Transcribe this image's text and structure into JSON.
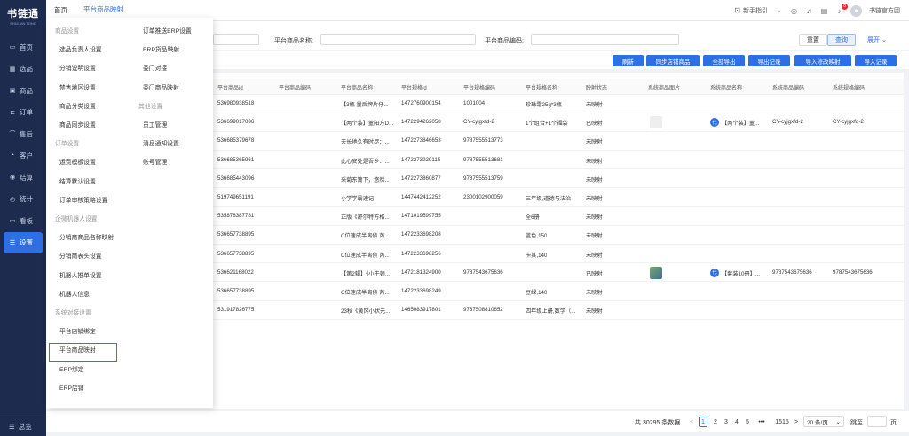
{
  "app": {
    "logo": "书链通",
    "logo_sub": "SHULIAN TONG"
  },
  "sidebar": {
    "items": [
      {
        "label": "首页",
        "icon": "monitor-icon"
      },
      {
        "label": "选品",
        "icon": "grid-icon"
      },
      {
        "label": "商品",
        "icon": "box-icon"
      },
      {
        "label": "订单",
        "icon": "cart-icon"
      },
      {
        "label": "售后",
        "icon": "headset-icon"
      },
      {
        "label": "客户",
        "icon": "user-icon"
      },
      {
        "label": "结算",
        "icon": "coin-icon"
      },
      {
        "label": "统计",
        "icon": "chart-icon"
      },
      {
        "label": "看板",
        "icon": "dashboard-icon"
      },
      {
        "label": "设置",
        "icon": "settings-icon"
      }
    ],
    "active_index": 9,
    "bottom_label": "总览"
  },
  "topbar": {
    "tabs": [
      "首页",
      "平台商品映射"
    ],
    "active_tab": 1,
    "guide_label": "新手指引",
    "notification_count": "8",
    "user_name": "书链官方团"
  },
  "filters": {
    "platform_name_label": "平台商品名称:",
    "platform_code_label": "平台商品编码:",
    "reset": "重置",
    "query": "查询",
    "expand": "展开"
  },
  "actions": {
    "buttons": [
      "刷新",
      "同步店铺商品",
      "全部导出",
      "导出记录",
      "导入修改映射",
      "导入记录"
    ]
  },
  "table": {
    "columns": [
      "平台商品id",
      "平台商品编码",
      "平台商品名称",
      "平台规格id",
      "平台规格编码",
      "平台规格名称",
      "映射状态",
      "系统商品图片",
      "系统商品名称",
      "系统商品编码",
      "系统规格编码"
    ],
    "rows": [
      {
        "pid": "536980938518",
        "code": "",
        "name": "【3瓶 量后牌片仔...",
        "sid": "1472760900154",
        "scode": "1001004",
        "sname": "珍珠霜25g*3瓶",
        "status": "未映射",
        "img": "",
        "sysname": "",
        "syscode": "",
        "sysscode": ""
      },
      {
        "pid": "536699017036",
        "code": "",
        "name": "【两个装】董阳方D...",
        "sid": "1472294262058",
        "scode": "CY-cyjgxfd-2",
        "sname": "1个组合+1个福袋",
        "status": "已映射",
        "img": "grey",
        "sysname": "【两个装】董...",
        "syscode": "CY-cyjgxfd-2",
        "sysscode": "CY-cyjgxfd-2"
      },
      {
        "pid": "536685379678",
        "code": "",
        "name": "天长地久有时尽：...",
        "sid": "1472273846653",
        "scode": "9787555513773",
        "sname": "",
        "status": "未映射",
        "img": "",
        "sysname": "",
        "syscode": "",
        "sysscode": ""
      },
      {
        "pid": "536685365961",
        "code": "",
        "name": "此心安处是吾乡：...",
        "sid": "1472273929115",
        "scode": "9787555513681",
        "sname": "",
        "status": "未映射",
        "img": "",
        "sysname": "",
        "syscode": "",
        "sysscode": ""
      },
      {
        "pid": "536685443096",
        "code": "",
        "name": "采菊东篱下，悠然...",
        "sid": "1472273860877",
        "scode": "9787555513759",
        "sname": "",
        "status": "未映射",
        "img": "",
        "sysname": "",
        "syscode": "",
        "sysscode": ""
      },
      {
        "pid": "519749651191",
        "code": "",
        "name": "小学学霸速记",
        "sid": "1447442412252",
        "scode": "2300102900059",
        "sname": "三年级,道德与法治",
        "status": "未映射",
        "img": "",
        "sysname": "",
        "syscode": "",
        "sysscode": ""
      },
      {
        "pid": "535876387781",
        "code": "",
        "name": "正版《舒尔特方格...",
        "sid": "1471019599755",
        "scode": "",
        "sname": "全6册",
        "status": "未映射",
        "img": "",
        "sysname": "",
        "syscode": "",
        "sysscode": ""
      },
      {
        "pid": "536657738895",
        "code": "",
        "name": "C位速成半离侦 芮...",
        "sid": "1472233698208",
        "scode": "",
        "sname": "蓝色,150",
        "status": "未映射",
        "img": "",
        "sysname": "",
        "syscode": "",
        "sysscode": ""
      },
      {
        "pid": "536657738895",
        "code": "",
        "name": "C位速成半离侦 芮...",
        "sid": "1472233698256",
        "scode": "",
        "sname": "卡其,140",
        "status": "未映射",
        "img": "",
        "sysname": "",
        "syscode": "",
        "sysscode": ""
      },
      {
        "pid": "536621168022",
        "code": "",
        "name": "【第2辑】《小牛顿...",
        "sid": "1472181324900",
        "scode": "9787543675636",
        "sname": "",
        "status": "已映射",
        "img": "color",
        "sysname": "【套装10册】...",
        "syscode": "9787543675636",
        "sysscode": "9787543675636"
      },
      {
        "pid": "536657738895",
        "code": "",
        "name": "C位速成半离侦 芮...",
        "sid": "1472233698249",
        "scode": "",
        "sname": "豆绿,140",
        "status": "未映射",
        "img": "",
        "sysname": "",
        "syscode": "",
        "sysscode": ""
      },
      {
        "pid": "531917826775",
        "code": "",
        "name": "23秋《黄冈小状元...",
        "sid": "1465083917801",
        "scode": "9787508810652",
        "sname": "四年级上册,数学（...",
        "status": "未映射",
        "img": "",
        "sysname": "",
        "syscode": "",
        "sysscode": ""
      }
    ]
  },
  "pagination": {
    "total": "共 30295 条数据",
    "pages": [
      "1",
      "2",
      "3",
      "4",
      "5",
      "•••",
      "1515"
    ],
    "prev": "<",
    "next": ">",
    "page_size": "20 条/页",
    "jump_label": "跳至",
    "jump_suffix": "页"
  },
  "dropdown": {
    "col1": [
      {
        "type": "section",
        "label": "商品设置"
      },
      {
        "type": "item",
        "label": "选品负责人设置"
      },
      {
        "type": "item",
        "label": "分销说明设置"
      },
      {
        "type": "item",
        "label": "禁售地区设置"
      },
      {
        "type": "item",
        "label": "商品分类设置"
      },
      {
        "type": "item",
        "label": "商品同步设置"
      },
      {
        "type": "section",
        "label": "订单设置"
      },
      {
        "type": "item",
        "label": "运费模板设置"
      },
      {
        "type": "item",
        "label": "结算默认设置"
      },
      {
        "type": "item",
        "label": "订单审核策略设置"
      },
      {
        "type": "section",
        "label": "企微机器人设置"
      },
      {
        "type": "item",
        "label": "分销商商品名称映射"
      },
      {
        "type": "item",
        "label": "分销商表头设置"
      },
      {
        "type": "item",
        "label": "机器人推单设置"
      },
      {
        "type": "item",
        "label": "机器人信息"
      },
      {
        "type": "section",
        "label": "系统对接设置"
      },
      {
        "type": "item",
        "label": "平台店铺绑定"
      },
      {
        "type": "item",
        "label": "平台商品映射"
      },
      {
        "type": "item",
        "label": "ERP绑定"
      },
      {
        "type": "item",
        "label": "ERP店铺"
      }
    ],
    "col2": [
      {
        "type": "item",
        "label": "订单推送ERP设置"
      },
      {
        "type": "item",
        "label": "ERP货品映射"
      },
      {
        "type": "item",
        "label": "委门对接"
      },
      {
        "type": "item",
        "label": "委门商品映射"
      },
      {
        "type": "section",
        "label": "其他设置"
      },
      {
        "type": "item",
        "label": "员工管理"
      },
      {
        "type": "item",
        "label": "消息通知设置"
      },
      {
        "type": "item",
        "label": "账号管理"
      }
    ]
  },
  "colors": {
    "primary": "#2f6fe4",
    "sidebar_bg": "#1d2b4f",
    "highlight": "#e53935"
  }
}
